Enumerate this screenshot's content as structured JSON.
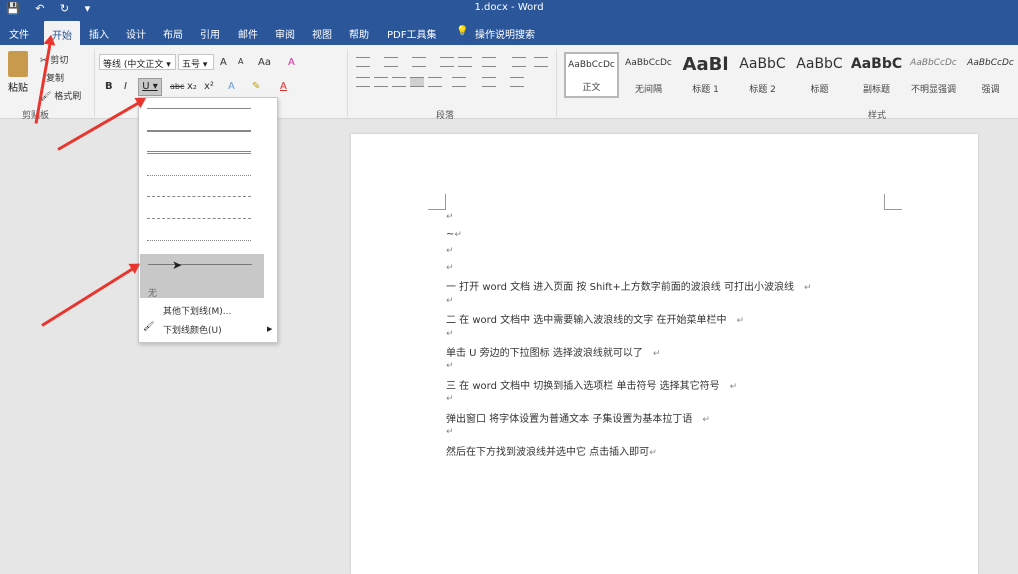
{
  "window": {
    "title": "1.docx  -  Word",
    "qat_icons": [
      "save-icon",
      "undo-icon",
      "redo-icon",
      "customize-icon"
    ]
  },
  "tabs": [
    "文件",
    "开始",
    "插入",
    "设计",
    "布局",
    "引用",
    "邮件",
    "审阅",
    "视图",
    "帮助",
    "PDF工具集",
    "操作说明搜索"
  ],
  "active_tab": "开始",
  "clipboard": {
    "paste": "粘贴",
    "cut": "剪切",
    "copy": "复制",
    "format_painter": "格式刷",
    "group": "剪贴板"
  },
  "font": {
    "name": "等线 (中文正文",
    "size": "五号",
    "grow": "A",
    "shrink": "A",
    "case": "Aa",
    "clear": "A",
    "bold": "B",
    "italic": "I",
    "underline": "U",
    "strike": "abc",
    "sub": "x₂",
    "sup": "x²",
    "color_a": "A"
  },
  "paragraph": {
    "group": "段落"
  },
  "styles": {
    "group": "样式",
    "items": [
      {
        "preview": "AaBbCcDc",
        "name": "正文"
      },
      {
        "preview": "AaBbCcDc",
        "name": "无间隔"
      },
      {
        "preview": "AaBl",
        "name": "标题 1"
      },
      {
        "preview": "AaBbC",
        "name": "标题 2"
      },
      {
        "preview": "AaBbC",
        "name": "标题"
      },
      {
        "preview": "AaBbC",
        "name": "副标题"
      },
      {
        "preview": "AaBbCcDc",
        "name": "不明显强调"
      },
      {
        "preview": "AaBbCcDc",
        "name": "强调"
      }
    ]
  },
  "underline_menu": {
    "none_label": "无",
    "more": "其他下划线(M)...",
    "color": "下划线颜色(U)"
  },
  "document": {
    "lines": [
      {
        "text": "一   打开 word 文档   进入页面   按 Shift+上方数字前面的波浪线   可打出小波浪线"
      },
      {
        "text": "二   在 word 文档中   选中需要输入波浪线的文字   在开始菜单栏中"
      },
      {
        "text": "单击 U 旁边的下拉图标   选择波浪线就可以了"
      },
      {
        "text": "三   在 word 文档中   切换到插入选项栏   单击符号   选择其它符号"
      },
      {
        "text": "弹出窗口   将字体设置为普通文本   子集设置为基本拉丁语"
      },
      {
        "text": "然后在下方找到波浪线并选中它   点击插入即可"
      }
    ],
    "wave_char": "~",
    "pmark": "↵"
  },
  "colors": {
    "ribbon_blue": "#2b579a",
    "annotation_red": "#e8362f"
  }
}
